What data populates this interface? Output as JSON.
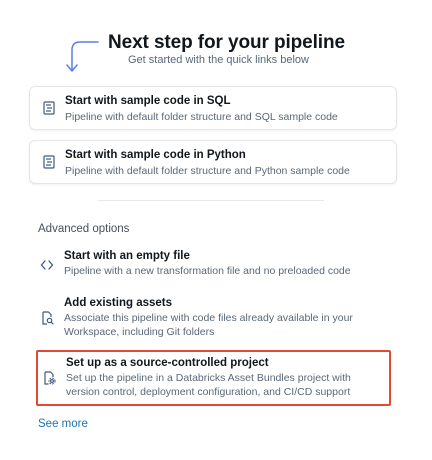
{
  "hero": {
    "title": "Next step for your pipeline",
    "subtitle": "Get started with the quick links below",
    "arrow_color": "#5b7fe0"
  },
  "quick_links": [
    {
      "title": "Start with sample code in SQL",
      "description": "Pipeline with default folder structure and SQL sample code",
      "icon": "code-file-icon"
    },
    {
      "title": "Start with sample code in Python",
      "description": "Pipeline with default folder structure and Python sample code",
      "icon": "code-file-icon"
    }
  ],
  "advanced": {
    "heading": "Advanced options",
    "options": [
      {
        "title": "Start with an empty file",
        "description": "Pipeline with a new transformation file and no preloaded code",
        "icon": "code-brackets-icon"
      },
      {
        "title": "Add existing assets",
        "description": "Associate this pipeline with code files already available in your Workspace, including Git folders",
        "icon": "file-search-icon"
      },
      {
        "title": "Set up as a source-controlled project",
        "description": "Set up the pipeline in a Databricks Asset Bundles project with version control, deployment configuration, and CI/CD support",
        "icon": "file-gear-icon",
        "highlighted": true
      }
    ]
  },
  "see_more_label": "See more",
  "colors": {
    "link": "#2272b4",
    "highlight": "#e14b33",
    "icon": "#3d5a80"
  }
}
